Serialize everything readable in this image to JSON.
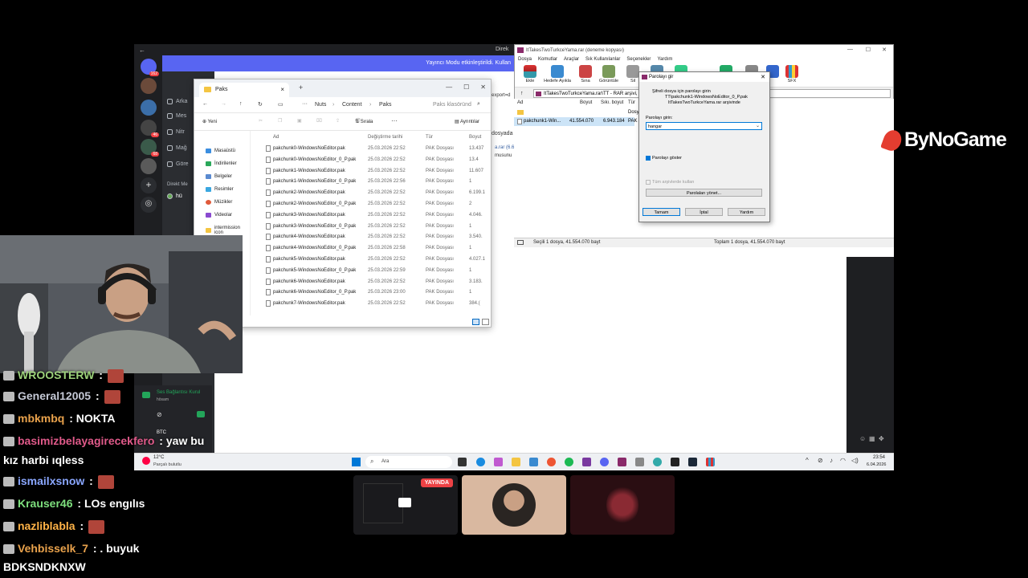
{
  "discord": {
    "banner": "Yayıncı Modu etkinleştirildi. Kullan",
    "title_right": "Direk",
    "badges": [
      "162",
      "46",
      "68"
    ],
    "sidebar_items": [
      "Arka",
      "Mes",
      "Nitr",
      "Mağ",
      "Göre"
    ],
    "dm_header": "Direkt Me",
    "dm_user": "hü",
    "voice_status": "Ses Bağlantısı Kurul",
    "voice_sub": "hösam",
    "voice_user": "BTC"
  },
  "explorer": {
    "tab_title": "Paks",
    "breadcrumb": [
      "Nuts",
      "Content",
      "Paks"
    ],
    "search_placeholder": "Paks klasöründ",
    "new_label": "Yeni",
    "sort_label": "Sırala",
    "details_label": "Ayrıntılar",
    "columns": [
      "Ad",
      "Değiştirme tarihi",
      "Tür",
      "Boyut"
    ],
    "tree": [
      "Masaüstü",
      "İndirilenler",
      "Belgeler",
      "Resimler",
      "Müzikler",
      "Videolar",
      "intermission icon"
    ],
    "files": [
      {
        "name": "pakchunk0-WindowsNoEditor.pak",
        "date": "25.03.2026 22:52",
        "type": "PAK Dosyası",
        "size": "13.437"
      },
      {
        "name": "pakchunk0-WindowsNoEditor_0_P.pak",
        "date": "25.03.2026 22:52",
        "type": "PAK Dosyası",
        "size": "13.4"
      },
      {
        "name": "pakchunk1-WindowsNoEditor.pak",
        "date": "25.03.2026 22:52",
        "type": "PAK Dosyası",
        "size": "11.607"
      },
      {
        "name": "pakchunk1-WindowsNoEditor_0_P.pak",
        "date": "25.03.2026 22:56",
        "type": "PAK Dosyası",
        "size": "1"
      },
      {
        "name": "pakchunk2-WindowsNoEditor.pak",
        "date": "25.03.2026 22:52",
        "type": "PAK Dosyası",
        "size": "6.199.1"
      },
      {
        "name": "pakchunk2-WindowsNoEditor_0_P.pak",
        "date": "25.03.2026 22:52",
        "type": "PAK Dosyası",
        "size": "2"
      },
      {
        "name": "pakchunk3-WindowsNoEditor.pak",
        "date": "25.03.2026 22:52",
        "type": "PAK Dosyası",
        "size": "4.046."
      },
      {
        "name": "pakchunk3-WindowsNoEditor_0_P.pak",
        "date": "25.03.2026 22:52",
        "type": "PAK Dosyası",
        "size": "1"
      },
      {
        "name": "pakchunk4-WindowsNoEditor.pak",
        "date": "25.03.2026 22:52",
        "type": "PAK Dosyası",
        "size": "3.540."
      },
      {
        "name": "pakchunk4-WindowsNoEditor_0_P.pak",
        "date": "25.03.2026 22:58",
        "type": "PAK Dosyası",
        "size": "1"
      },
      {
        "name": "pakchunk5-WindowsNoEditor.pak",
        "date": "25.03.2026 22:52",
        "type": "PAK Dosyası",
        "size": "4.027.1"
      },
      {
        "name": "pakchunk5-WindowsNoEditor_0_P.pak",
        "date": "25.03.2026 22:59",
        "type": "PAK Dosyası",
        "size": "1"
      },
      {
        "name": "pakchunk6-WindowsNoEditor.pak",
        "date": "25.03.2026 22:52",
        "type": "PAK Dosyası",
        "size": "3.183."
      },
      {
        "name": "pakchunk6-WindowsNoEditor_0_P.pak",
        "date": "25.03.2026 23:00",
        "type": "PAK Dosyası",
        "size": "1"
      },
      {
        "name": "pakchunk7-WindowsNoEditor.pak",
        "date": "25.03.2026 22:52",
        "type": "PAK Dosyası",
        "size": "384.("
      }
    ]
  },
  "winrar": {
    "title": "ItTakesTwoTurkceYama.rar (deneme kopyası)",
    "menu": [
      "Dosya",
      "Komutlar",
      "Araçlar",
      "Sık Kullanılanlar",
      "Seçenekler",
      "Yardım"
    ],
    "toolbar": [
      "Ekle",
      "Hedefe Ayıkla",
      "Sına",
      "Görüntüle",
      "Sil",
      "Bul",
      "Sihirbaz",
      "Bilgi",
      "Virüs",
      "Yorum",
      "Koru",
      "SFX"
    ],
    "address": "ItTakesTwoTurkceYama.rar\\TT - RAR arşivi, aç",
    "columns": [
      "Ad",
      "Boyut",
      "Sıkı. boyut",
      "Tür"
    ],
    "parent_type": "Dosy",
    "file": {
      "name": "pakchunk1-Win...",
      "size": "41.554.070",
      "packed": "6.943.184",
      "type": "PAK"
    },
    "status_left": "Seçili 1 dosya, 41.554.070 bayt",
    "status_right": "Toplam 1 dosya, 41.554.070 bayt",
    "behind_text_1": "export=d",
    "behind_text_2": "dosyada",
    "behind_text_3": "a.rar (6.6",
    "behind_text_4": "musunu"
  },
  "dialog": {
    "title": "Parolayı gir",
    "msg1": "Şifreli dosya için parolayı girin",
    "msg2": "TT\\pakchunk1-WindowsNoEditor_0_P.pak",
    "msg3": "ItTakesTwoTurkceYama.rar arşivinde",
    "label": "Parolayı girin:",
    "password_value": "hangar",
    "show_pw": "Parolayı göster",
    "all_archives": "Tüm arşivlerde kullan",
    "manage": "Parolaları yönet...",
    "ok": "Tamam",
    "cancel": "İptal",
    "help": "Yardım"
  },
  "taskbar": {
    "temp": "12°C",
    "weather": "Parçalı bulutlu",
    "search": "Ara",
    "time": "23:54",
    "date": "6.04.2026"
  },
  "logo": "ByNoGame",
  "live_label": "YAYINDA",
  "chat": [
    {
      "user": "WROOSTERW",
      "msg": "",
      "color": "#9cd17a",
      "emote": true
    },
    {
      "user": "General12005",
      "msg": "",
      "color": "#c5c9d6",
      "emote": true
    },
    {
      "user": "mbkmbq",
      "msg": "NOKTA",
      "color": "#e9a24c",
      "emote": false
    },
    {
      "user": "basimizbelayagirecekfero",
      "msg": "yaw bu",
      "color": "#e05a8a",
      "emote": false
    },
    {
      "user": "",
      "msg": "kız harbi ıqless",
      "color": "#fff",
      "emote": false
    },
    {
      "user": "ismailxsnow",
      "msg": "",
      "color": "#8aa7ff",
      "emote": true
    },
    {
      "user": "Krauser46",
      "msg": "LOs engılıs",
      "color": "#7ee07e",
      "emote": false
    },
    {
      "user": "nazliblabla",
      "msg": "",
      "color": "#ffb347",
      "emote": true
    },
    {
      "user": "Vehbisselk_7",
      "msg": ". buyuk",
      "color": "#e9a24c",
      "emote": false
    },
    {
      "user": "",
      "msg": "BDKSNDKNXW",
      "color": "#fff",
      "emote": false
    }
  ]
}
